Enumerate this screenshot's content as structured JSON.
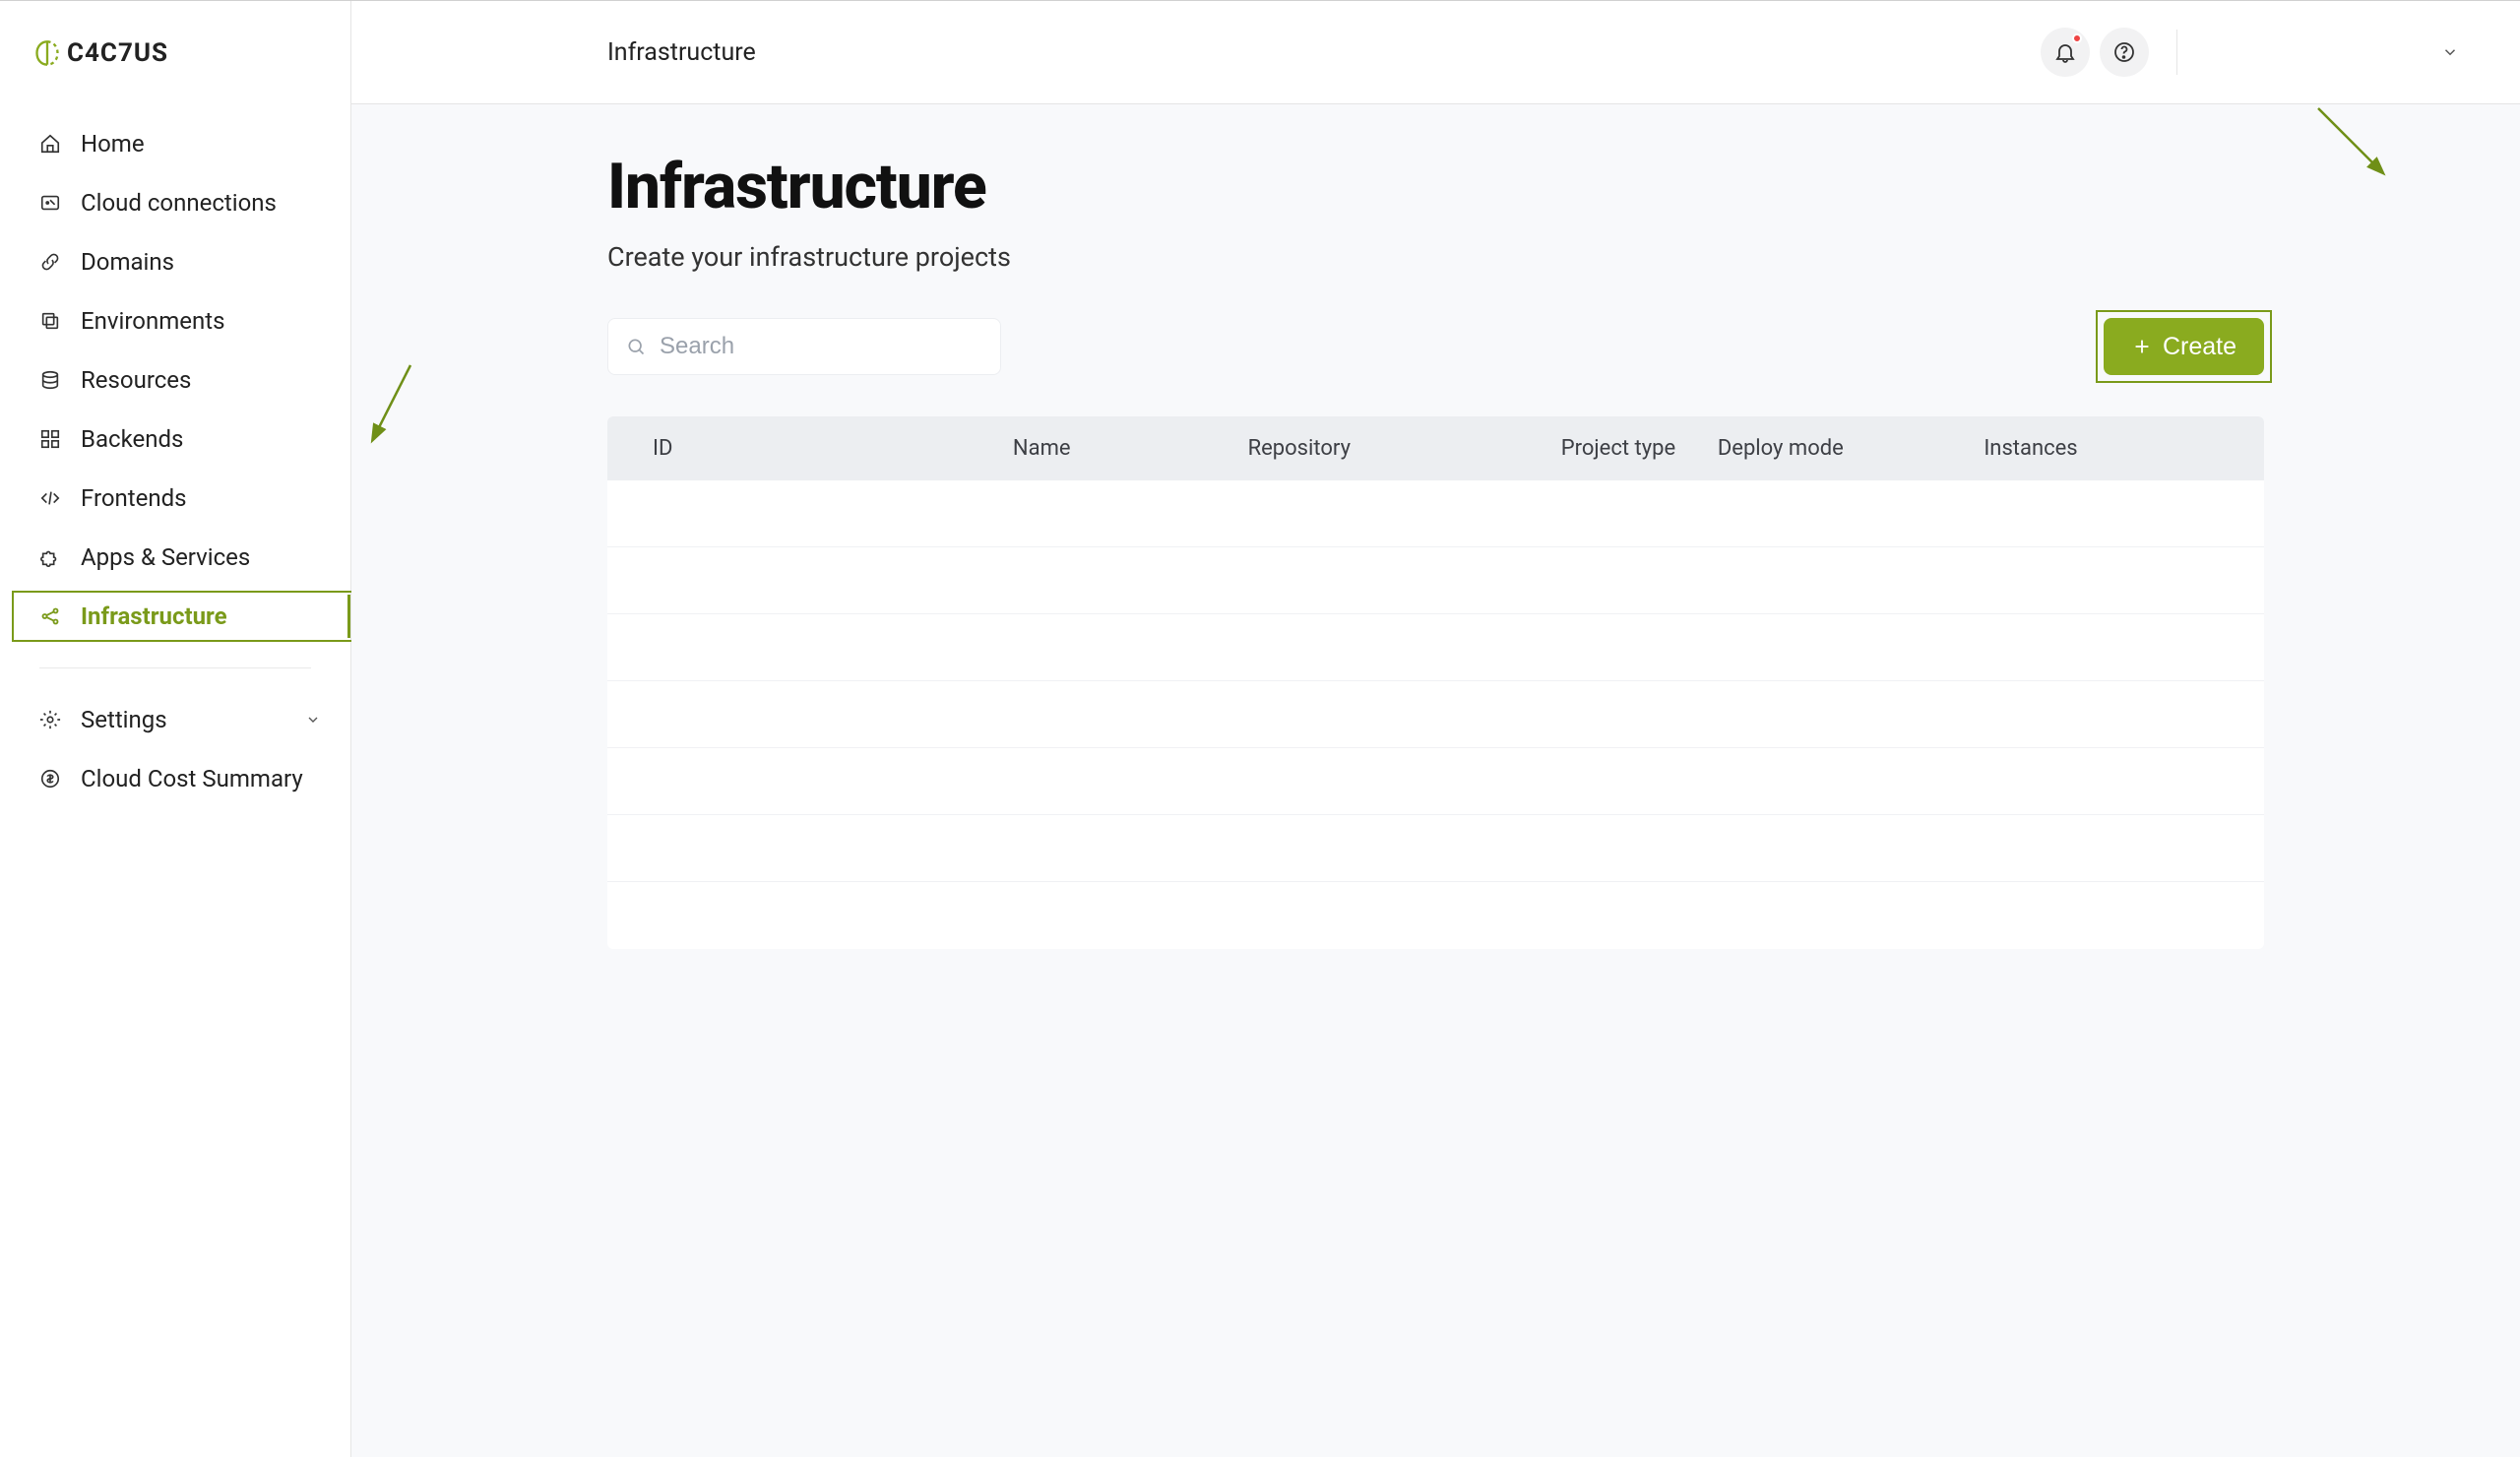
{
  "brand": {
    "name": "C4C7US"
  },
  "sidebar": {
    "items": [
      {
        "label": "Home",
        "icon": "home-icon"
      },
      {
        "label": "Cloud connections",
        "icon": "cloud-link-icon"
      },
      {
        "label": "Domains",
        "icon": "link-icon"
      },
      {
        "label": "Environments",
        "icon": "layers-icon"
      },
      {
        "label": "Resources",
        "icon": "database-icon"
      },
      {
        "label": "Backends",
        "icon": "grid-icon"
      },
      {
        "label": "Frontends",
        "icon": "code-icon"
      },
      {
        "label": "Apps & Services",
        "icon": "puzzle-icon"
      },
      {
        "label": "Infrastructure",
        "icon": "share-icon"
      }
    ],
    "bottom": [
      {
        "label": "Settings",
        "icon": "gear-icon",
        "expandable": true
      },
      {
        "label": "Cloud Cost Summary",
        "icon": "dollar-icon"
      }
    ]
  },
  "header": {
    "breadcrumb": "Infrastructure"
  },
  "main": {
    "title": "Infrastructure",
    "subtitle": "Create your infrastructure projects",
    "search_placeholder": "Search",
    "create_label": "Create",
    "table": {
      "columns": [
        "ID",
        "Name",
        "Repository",
        "Project type",
        "Deploy mode",
        "Instances"
      ],
      "rows": 7
    }
  },
  "colors": {
    "accent": "#8aab1f",
    "accent_border": "#7a9a1a",
    "panel_bg": "#f8f9fb",
    "thead_bg": "#eceef1"
  }
}
